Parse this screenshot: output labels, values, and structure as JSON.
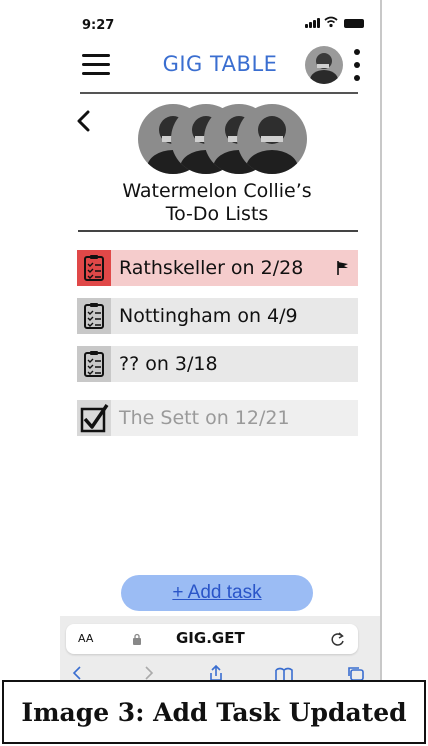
{
  "status_bar": {
    "time": "9:27"
  },
  "header": {
    "title": "GIG TABLE"
  },
  "band": {
    "name": "Watermelon Collie’s",
    "subtitle": "To-Do Lists"
  },
  "todo_lists": [
    {
      "label": "Rathskeller on 2/28",
      "state": "active",
      "flagged": true,
      "icon": "clipboard-list-icon"
    },
    {
      "label": "Nottingham on 4/9",
      "state": "normal",
      "flagged": false,
      "icon": "clipboard-list-icon"
    },
    {
      "label": "?? on 3/18",
      "state": "normal",
      "flagged": false,
      "icon": "clipboard-list-icon"
    },
    {
      "label": "The Sett on 12/21",
      "state": "completed",
      "flagged": false,
      "icon": "checkbox-checked-icon"
    }
  ],
  "actions": {
    "add_task": "+ Add task"
  },
  "browser": {
    "text_size": "AA",
    "url": "GIG.GET"
  },
  "caption": "Image 3: Add Task Updated",
  "colors": {
    "title_blue": "#3a6ed0",
    "active_row": "#f5cccc",
    "active_icon_bg": "#e04848",
    "row_bg": "#e8e8e8",
    "completed_text": "#9a9a9a",
    "add_button_bg": "#9bbcf4",
    "add_button_text": "#2a55c8"
  }
}
